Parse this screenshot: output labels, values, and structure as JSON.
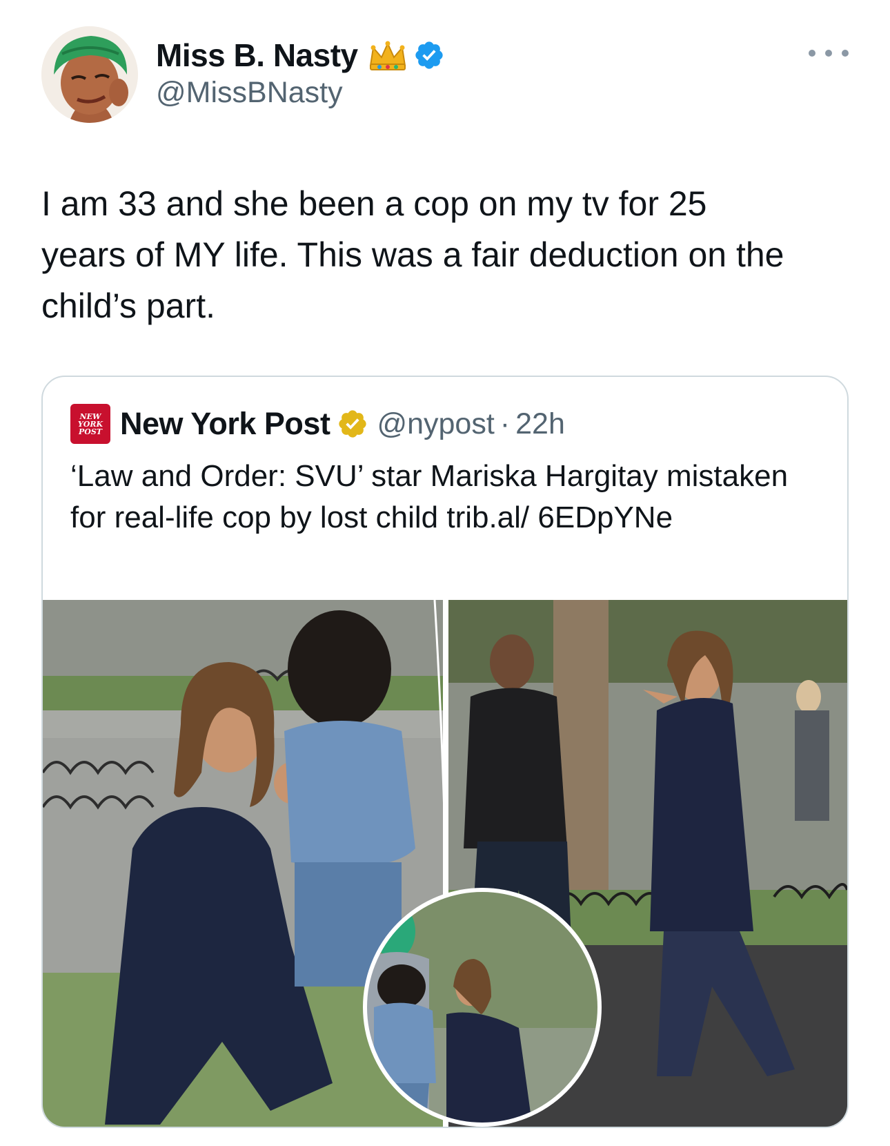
{
  "tweet": {
    "author": {
      "display_name": "Miss B. Nasty",
      "handle": "@MissBNasty",
      "badge_emoji": "crown",
      "verified": true,
      "verified_color": "#1d9bf0"
    },
    "text": "I am 33 and she been a cop on my tv for 25\nyears of MY life. This was a fair deduction on the\nchild’s part."
  },
  "quoted_tweet": {
    "logo_text": [
      "NEW",
      "YORK",
      "POST"
    ],
    "author_name": "New York Post",
    "verified": true,
    "verified_color": "#e2b719",
    "handle": "@nypost",
    "separator": "·",
    "time": "22h",
    "text": "‘Law and Order: SVU’ star Mariska Hargitay mistaken for real-life cop by lost child trib.al/ 6EDpYNe",
    "media": {
      "kind": "photo-collage",
      "panels": [
        "woman-kneeling-with-child",
        "two-actors-in-park",
        "circular-inset-woman-and-child"
      ]
    }
  },
  "icons": {
    "more": "more-horizontal-icon",
    "verified": "verified-badge-icon",
    "crown": "crown-emoji-icon"
  }
}
